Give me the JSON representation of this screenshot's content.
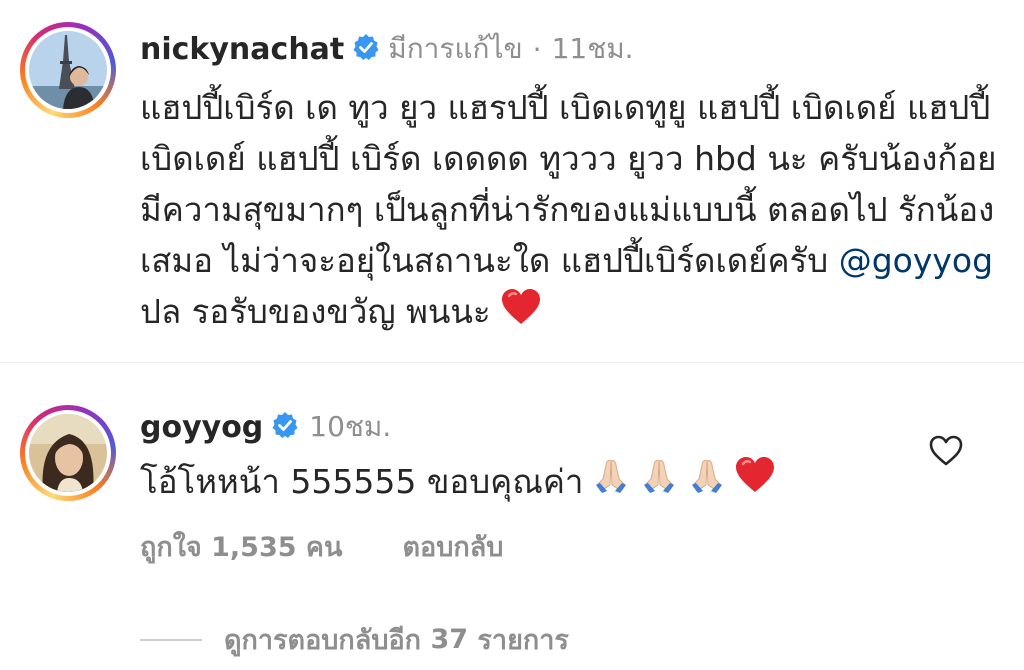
{
  "post": {
    "username": "nickynachat",
    "edited_label": "มีการแก้ไข",
    "separator": "·",
    "time": "11ชม.",
    "caption_part1": "แฮปปี้เบิร์ด เด ทูว ยูว แฮรปปี้ เบิดเดทูยู แฮปปี้ เบิดเดย์ แฮปปี้ เบิดเดย์ แฮปปี้ เบิร์ด เดดดด ทูววว ยูวว hbd นะ ครับน้องก้อย มีความสุขมากๆ เป็นลูกที่น่ารักของแม่แบบนี้ ตลอดไป รักน้องเสมอ ไม่ว่าจะอยุ่ในสถานะใด แฮปปี้เบิร์ดเดย์ครับ ",
    "mention": "@goyyog",
    "caption_part2": "  ปล รอรับของขวัญ พนนะ ",
    "caption_emoji": "red-heart-emoji"
  },
  "reply": {
    "username": "goyyog",
    "time": "10ชม.",
    "text": "โอ้โหหน้า 555555 ขอบคุณค่า ",
    "emojis": [
      "folded-hands-emoji",
      "folded-hands-emoji",
      "folded-hands-emoji",
      "red-heart-emoji"
    ],
    "likes_label": "ถูกใจ",
    "likes_count": "1,535",
    "likes_unit": "คน",
    "reply_label": "ตอบกลับ",
    "like_icon": "heart-outline-icon"
  },
  "view_more": {
    "prefix": "ดูการตอบกลับอีก",
    "count": "37",
    "suffix": "รายการ"
  },
  "colors": {
    "text": "#262626",
    "secondary": "#8e8e8e",
    "verified": "#3897f0",
    "mention": "#00376b",
    "heart": "#ed4956"
  }
}
